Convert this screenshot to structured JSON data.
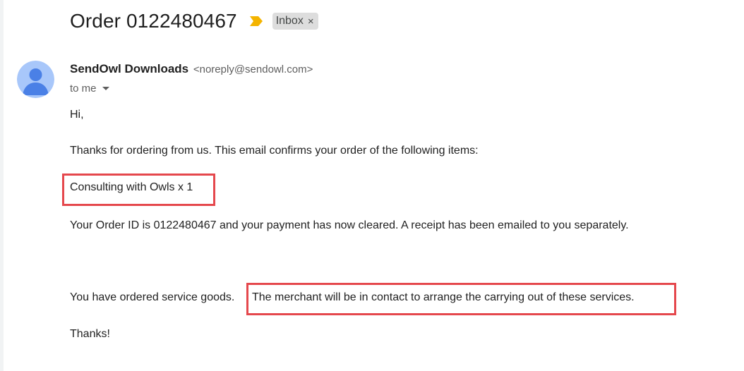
{
  "email": {
    "subject": "Order 0122480467",
    "importance_icon": "importance-marker-icon",
    "label": {
      "name": "Inbox",
      "close_glyph": "×"
    },
    "sender": {
      "name": "SendOwl Downloads",
      "email": "<noreply@sendowl.com>",
      "avatar_icon": "person-avatar-icon"
    },
    "recipient": {
      "text": "to me"
    },
    "body": {
      "greeting": "Hi,",
      "thanks": "Thanks for ordering from us. This email confirms your order of the following items:",
      "item": "Consulting with Owls x 1",
      "order_info": "Your Order ID is 0122480467 and your payment has now cleared. A receipt has been emailed to you separately.",
      "service_intro": "You have ordered service goods.",
      "service_detail": "The merchant will be in contact to arrange the carrying out of these services.",
      "signoff": "Thanks!"
    }
  },
  "colors": {
    "highlight_border": "#e5484d",
    "importance_yellow": "#f4b400",
    "avatar_bg": "#a8c7fa",
    "avatar_fg": "#4a80e6",
    "label_bg": "#dddddd"
  }
}
